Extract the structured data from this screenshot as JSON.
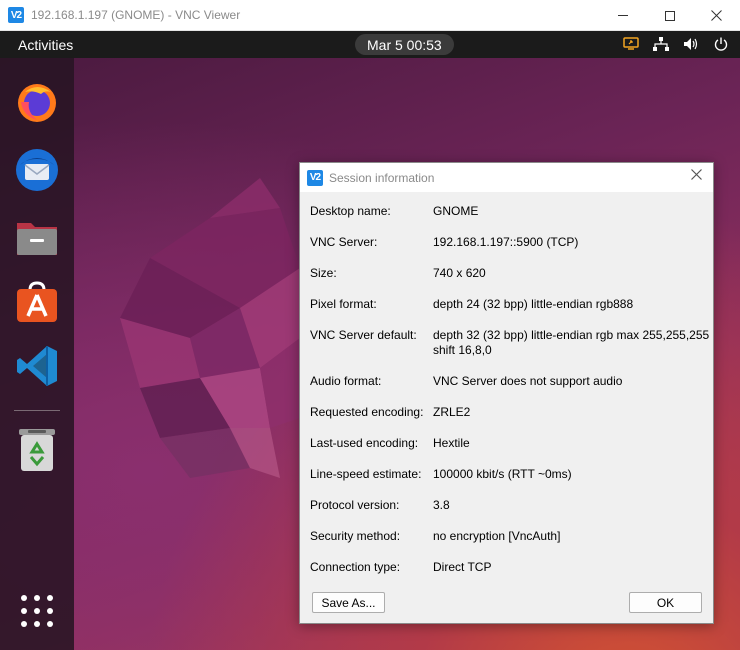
{
  "window": {
    "title": "192.168.1.197 (GNOME) - VNC Viewer",
    "logo_text": "V2"
  },
  "topbar": {
    "activities": "Activities",
    "clock": "Mar 5  00:53"
  },
  "dock": {
    "items": [
      "firefox-icon",
      "thunderbird-icon",
      "files-icon",
      "app-center-icon",
      "vscode-icon",
      "trash-icon",
      "show-apps-icon"
    ]
  },
  "dialog": {
    "title": "Session information",
    "rows": [
      {
        "label": "Desktop name:",
        "value": "GNOME"
      },
      {
        "label": "VNC Server:",
        "value": "192.168.1.197::5900 (TCP)"
      },
      {
        "label": "Size:",
        "value": "740 x 620"
      },
      {
        "label": "Pixel format:",
        "value": "depth 24 (32 bpp) little-endian rgb888"
      },
      {
        "label": "VNC Server default:",
        "value": "depth 32 (32 bpp) little-endian rgb max 255,255,255 shift 16,8,0"
      },
      {
        "label": "Audio format:",
        "value": "VNC Server does not support audio"
      },
      {
        "label": "Requested encoding:",
        "value": "ZRLE2"
      },
      {
        "label": "Last-used encoding:",
        "value": "Hextile"
      },
      {
        "label": "Line-speed estimate:",
        "value": "100000 kbit/s (RTT ~0ms)"
      },
      {
        "label": "Protocol version:",
        "value": "3.8"
      },
      {
        "label": "Security method:",
        "value": "no encryption [VncAuth]"
      },
      {
        "label": "Connection type:",
        "value": "Direct TCP"
      }
    ],
    "save_as_label": "Save As...",
    "ok_label": "OK"
  },
  "colors": {
    "accent": "#1e88e5",
    "topbar_bg": "#1b1b1b",
    "dialog_bg": "#f0f0f0"
  }
}
